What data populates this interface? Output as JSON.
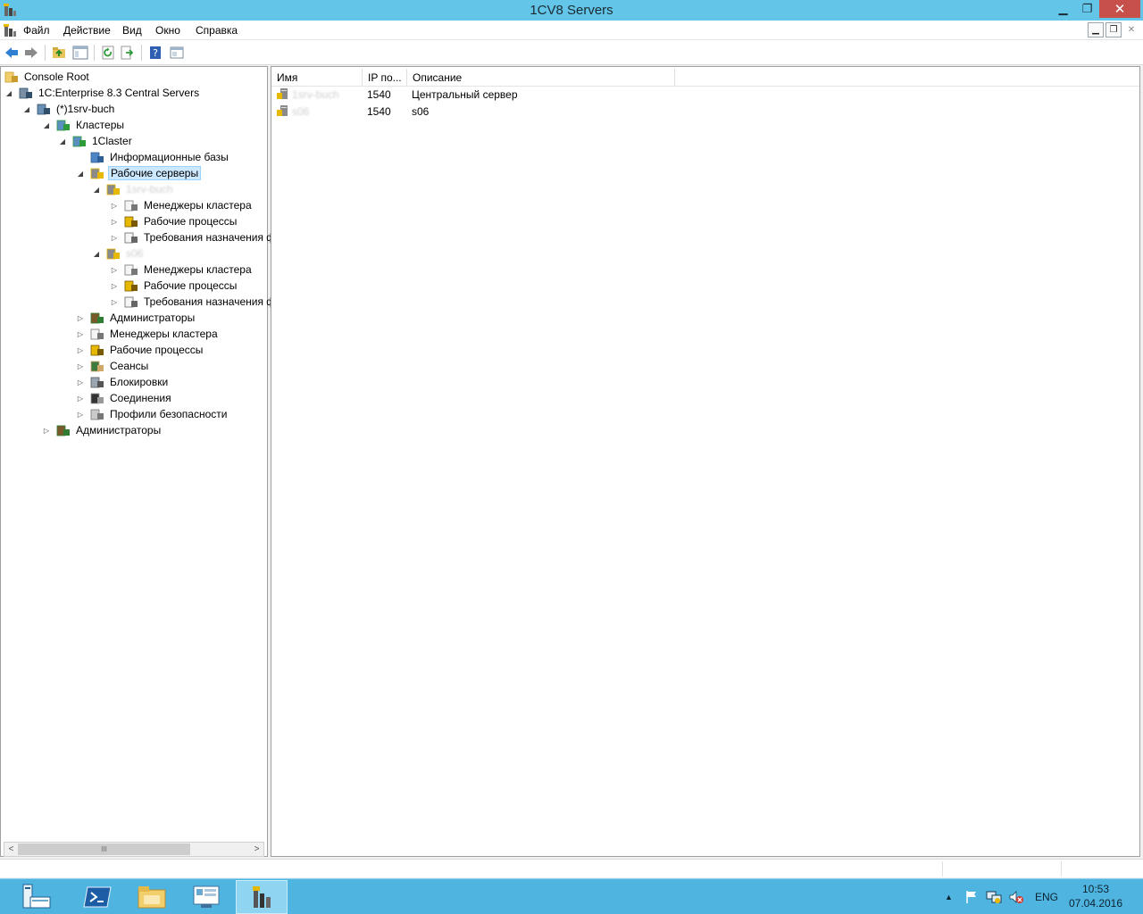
{
  "window": {
    "title": "1CV8 Servers",
    "minimize_glyph": "▁",
    "maximize_glyph": "❐",
    "close_glyph": "✕"
  },
  "menu": {
    "items": [
      "Файл",
      "Действие",
      "Вид",
      "Окно",
      "Справка"
    ],
    "mdi_buttons": [
      "▁",
      "❐",
      "✕"
    ]
  },
  "toolbar": {
    "buttons": [
      "back-icon",
      "forward-icon",
      "up-folder-icon",
      "show-hide-tree-icon",
      "refresh-icon",
      "export-list-icon",
      "help-icon",
      "properties-icon"
    ]
  },
  "tree": {
    "items": [
      {
        "label": "Console Root",
        "icon": "folder-icon",
        "arrow": ""
      },
      {
        "label": "1C:Enterprise 8.3 Central Servers",
        "icon": "servers-icon",
        "arrow": "◢"
      },
      {
        "label": "(*)1srv-buch",
        "icon": "server-icon",
        "arrow": "◢"
      },
      {
        "label": "Кластеры",
        "icon": "clusters-icon",
        "arrow": "◢"
      },
      {
        "label": "1Claster",
        "icon": "cluster-icon",
        "arrow": "◢"
      },
      {
        "label": "Информационные базы",
        "icon": "database-icon",
        "arrow": ""
      },
      {
        "label": "Рабочие серверы",
        "icon": "work-servers-icon",
        "arrow": "◢"
      },
      {
        "label": "1srv-buch",
        "icon": "work-server-icon",
        "arrow": "◢"
      },
      {
        "label": "Менеджеры кластера",
        "icon": "managers-icon",
        "arrow": "▷"
      },
      {
        "label": "Рабочие процессы",
        "icon": "processes-icon",
        "arrow": "▷"
      },
      {
        "label": "Требования назначения ф",
        "icon": "requirements-icon",
        "arrow": "▷"
      },
      {
        "label": "s06",
        "icon": "work-server-icon",
        "arrow": "◢"
      },
      {
        "label": "Менеджеры кластера",
        "icon": "managers-icon",
        "arrow": "▷"
      },
      {
        "label": "Рабочие процессы",
        "icon": "processes-icon",
        "arrow": "▷"
      },
      {
        "label": "Требования назначения ф",
        "icon": "requirements-icon",
        "arrow": "▷"
      },
      {
        "label": "Администраторы",
        "icon": "admins-icon",
        "arrow": "▷"
      },
      {
        "label": "Менеджеры кластера",
        "icon": "managers-icon",
        "arrow": "▷"
      },
      {
        "label": "Рабочие процессы",
        "icon": "processes-icon",
        "arrow": "▷"
      },
      {
        "label": "Сеансы",
        "icon": "sessions-icon",
        "arrow": "▷"
      },
      {
        "label": "Блокировки",
        "icon": "locks-icon",
        "arrow": "▷"
      },
      {
        "label": "Соединения",
        "icon": "connections-icon",
        "arrow": "▷"
      },
      {
        "label": "Профили безопасности",
        "icon": "security-profiles-icon",
        "arrow": "▷"
      },
      {
        "label": "Администраторы",
        "icon": "admins-icon",
        "arrow": "▷"
      }
    ],
    "scroll_thumb_glyph": "III",
    "scroll_left_glyph": "<",
    "scroll_right_glyph": ">"
  },
  "list": {
    "columns": [
      "Имя",
      "IP по...",
      "Описание"
    ],
    "rows": [
      {
        "name": "1srv-buch",
        "port": "1540",
        "description": "Центральный сервер"
      },
      {
        "name": "s06",
        "port": "1540",
        "description": "s06"
      }
    ]
  },
  "taskbar": {
    "apps": [
      "server-manager-icon",
      "powershell-icon",
      "file-explorer-icon",
      "control-panel-icon",
      "1c-servers-icon"
    ],
    "tray": {
      "language": "ENG",
      "time": "10:53",
      "date": "07.04.2016"
    }
  }
}
